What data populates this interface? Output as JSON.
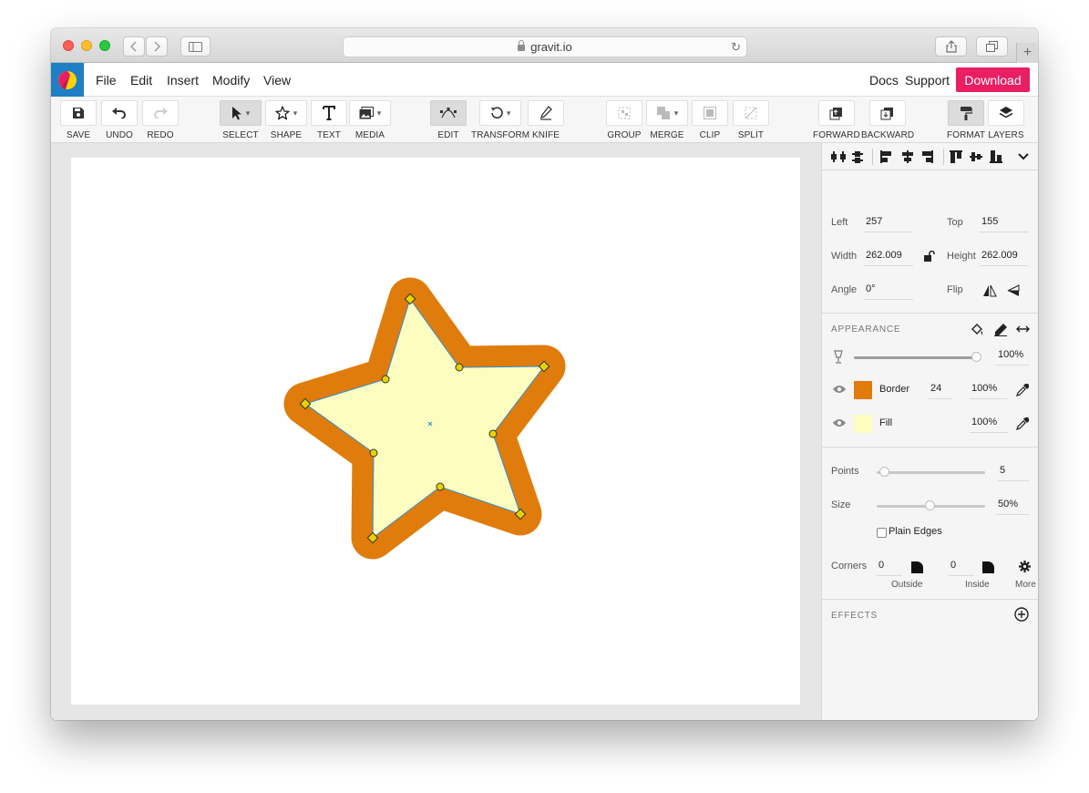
{
  "browser": {
    "url": "gravit.io"
  },
  "menubar": {
    "items": [
      "File",
      "Edit",
      "Insert",
      "Modify",
      "View"
    ],
    "right_links": [
      "Docs",
      "Support"
    ],
    "download_label": "Download"
  },
  "toolbar": {
    "tools": [
      {
        "label": "SAVE"
      },
      {
        "label": "UNDO"
      },
      {
        "label": "REDO"
      },
      {
        "label": "SELECT"
      },
      {
        "label": "SHAPE"
      },
      {
        "label": "TEXT"
      },
      {
        "label": "MEDIA"
      },
      {
        "label": "EDIT"
      },
      {
        "label": "TRANSFORM"
      },
      {
        "label": "KNIFE"
      },
      {
        "label": "GROUP"
      },
      {
        "label": "MERGE"
      },
      {
        "label": "CLIP"
      },
      {
        "label": "SPLIT"
      },
      {
        "label": "FORWARD"
      },
      {
        "label": "BACKWARD"
      },
      {
        "label": "FORMAT"
      },
      {
        "label": "LAYERS"
      }
    ]
  },
  "inspector": {
    "left_label": "Left",
    "left_value": "257",
    "top_label": "Top",
    "top_value": "155",
    "width_label": "Width",
    "width_value": "262.009",
    "height_label": "Height",
    "height_value": "262.009",
    "angle_label": "Angle",
    "angle_value": "0°",
    "flip_label": "Flip"
  },
  "appearance": {
    "title": "APPEARANCE",
    "opacity": "100%",
    "opacity_level": 1.0,
    "border_label": "Border",
    "border_width": "24",
    "border_opacity": "100%",
    "border_color": "#e07c0b",
    "fill_label": "Fill",
    "fill_opacity": "100%",
    "fill_color": "#fdfdc0"
  },
  "star": {
    "points_label": "Points",
    "points_value": "5",
    "size_label": "Size",
    "size_value": "50%",
    "plain_edges_label": "Plain Edges",
    "corners_label": "Corners",
    "outside_value": "0",
    "outside_label": "Outside",
    "inside_value": "0",
    "inside_label": "Inside",
    "more_label": "More"
  },
  "effects": {
    "title": "EFFECTS"
  },
  "colors": {
    "accent": "#e91e63",
    "logo_bg": "#1e7fc4",
    "star_stroke": "#e07c0b",
    "star_fill": "#fdfdc0",
    "handle": "#e6d200",
    "path_outline": "#2c8fd6"
  }
}
